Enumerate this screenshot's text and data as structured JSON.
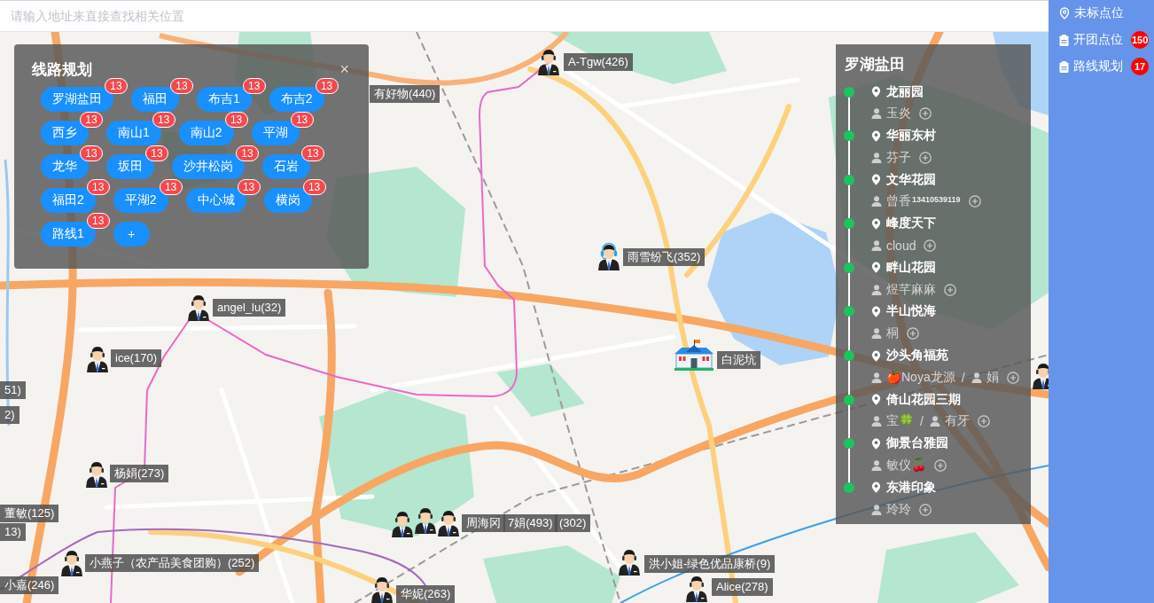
{
  "search": {
    "placeholder": "请输入地址来直接查找相关位置"
  },
  "map": {
    "markers": [
      {
        "kind": "person",
        "label": "A-Tgw(426)"
      },
      {
        "kind": "label",
        "label": "有好物(440)"
      },
      {
        "kind": "agent",
        "label": "雨雪纷飞(352)"
      },
      {
        "kind": "person",
        "label": "angel_lu(32)"
      },
      {
        "kind": "person",
        "label": "ice(170)"
      },
      {
        "kind": "school",
        "label": "白泥坑"
      },
      {
        "kind": "person"
      },
      {
        "kind": "label",
        "label": "51)"
      },
      {
        "kind": "label",
        "label": "2)"
      },
      {
        "kind": "person",
        "label": "杨娟(273)"
      },
      {
        "kind": "label",
        "label": "董敏(125)"
      },
      {
        "kind": "person",
        "label": "周海冈"
      },
      {
        "kind": "person",
        "label": "7娟(493)"
      },
      {
        "kind": "person",
        "label": "(302)"
      },
      {
        "kind": "label",
        "label": "13)"
      },
      {
        "kind": "person",
        "label": "小燕子（农产品美食团购）(252)"
      },
      {
        "kind": "person",
        "label": "洪小姐-绿色优品康桥(9)"
      },
      {
        "kind": "label",
        "label": "小嘉(246)"
      },
      {
        "kind": "person",
        "label": "Alice(278)"
      },
      {
        "kind": "person",
        "label": "华妮(263)"
      }
    ]
  },
  "route_panel": {
    "title": "线路规划",
    "close": "×",
    "routes": [
      {
        "label": "罗湖盐田",
        "count": "13"
      },
      {
        "label": "福田",
        "count": "13"
      },
      {
        "label": "布吉1",
        "count": "13"
      },
      {
        "label": "布吉2",
        "count": "13"
      },
      {
        "label": "西乡",
        "count": "13"
      },
      {
        "label": "南山1",
        "count": "13"
      },
      {
        "label": "南山2",
        "count": "13"
      },
      {
        "label": "平湖",
        "count": "13"
      },
      {
        "label": "龙华",
        "count": "13"
      },
      {
        "label": "坂田",
        "count": "13"
      },
      {
        "label": "沙井松岗",
        "count": "13"
      },
      {
        "label": "石岩",
        "count": "13"
      },
      {
        "label": "福田2",
        "count": "13"
      },
      {
        "label": "平湖2",
        "count": "13"
      },
      {
        "label": "中心城",
        "count": "13"
      },
      {
        "label": "横岗",
        "count": "13"
      },
      {
        "label": "路线1",
        "count": "13"
      }
    ],
    "add_label": "+"
  },
  "route_detail": {
    "title": "罗湖盐田",
    "stops": [
      {
        "name": "龙丽园",
        "members": [
          {
            "name": "玉炎"
          }
        ]
      },
      {
        "name": "华丽东村",
        "members": [
          {
            "name": "芬子"
          }
        ]
      },
      {
        "name": "文华花园",
        "members": [
          {
            "name": "曾香",
            "phone": "13410539119"
          }
        ]
      },
      {
        "name": "峰度天下",
        "members": [
          {
            "name": "cloud"
          }
        ]
      },
      {
        "name": "畔山花园",
        "members": [
          {
            "name": "煜芊麻麻"
          }
        ]
      },
      {
        "name": "半山悦海",
        "members": [
          {
            "name": "桐"
          }
        ]
      },
      {
        "name": "沙头角福苑",
        "members": [
          {
            "name": "🍎Noya龙源"
          },
          {
            "separator": "/",
            "name": "娟"
          }
        ]
      },
      {
        "name": "倚山花园三期",
        "members": [
          {
            "name": "宝🍀"
          },
          {
            "separator": "/",
            "name": "有牙"
          }
        ]
      },
      {
        "name": "御景台雅园",
        "members": [
          {
            "name": "敏仪🍒"
          }
        ]
      },
      {
        "name": "东港印象",
        "members": [
          {
            "name": "玲玲"
          }
        ]
      }
    ]
  },
  "sidebar": {
    "items": [
      {
        "label": "未标点位"
      },
      {
        "label": "开团点位",
        "badge": "150"
      },
      {
        "label": "路线规划",
        "badge": "17"
      }
    ]
  }
}
